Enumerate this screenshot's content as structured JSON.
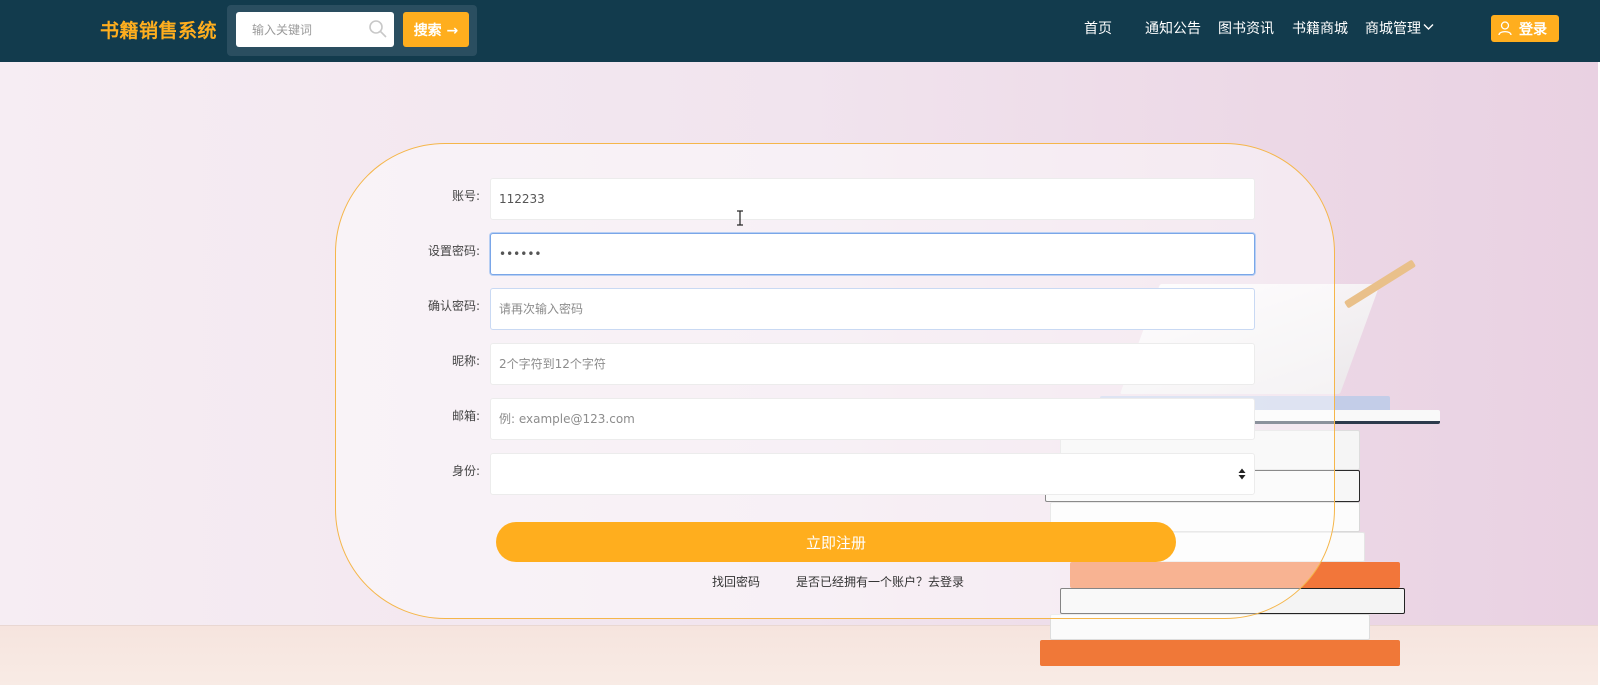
{
  "header": {
    "brand": "书籍销售系统",
    "search": {
      "placeholder": "输入关键词",
      "button_label": "搜索 →"
    },
    "nav": [
      {
        "label": "首页"
      },
      {
        "label": "通知公告"
      },
      {
        "label": "图书资讯"
      },
      {
        "label": "书籍商城"
      },
      {
        "label": "商城管理"
      }
    ],
    "login_label": "登录"
  },
  "form": {
    "fields": [
      {
        "label": "账号:",
        "value": "112233",
        "placeholder": ""
      },
      {
        "label": "设置密码:",
        "value": "112233",
        "placeholder": ""
      },
      {
        "label": "确认密码:",
        "value": "",
        "placeholder": "请再次输入密码"
      },
      {
        "label": "昵称:",
        "value": "",
        "placeholder": "2个字符到12个字符"
      },
      {
        "label": "邮箱:",
        "value": "",
        "placeholder": "例: example@123.com"
      },
      {
        "label": "身份:",
        "value": ""
      }
    ],
    "submit_label": "立即注册",
    "forgot_label": "找回密码",
    "login_link_label": "是否已经拥有一个账户？去登录"
  },
  "colors": {
    "header_bg": "#123b4d",
    "accent": "#ffae1e",
    "focus_border": "#7aa6e8"
  },
  "icons": [
    "search-icon",
    "chevron-down-icon",
    "user-icon",
    "select-arrows-icon",
    "text-cursor-icon"
  ]
}
